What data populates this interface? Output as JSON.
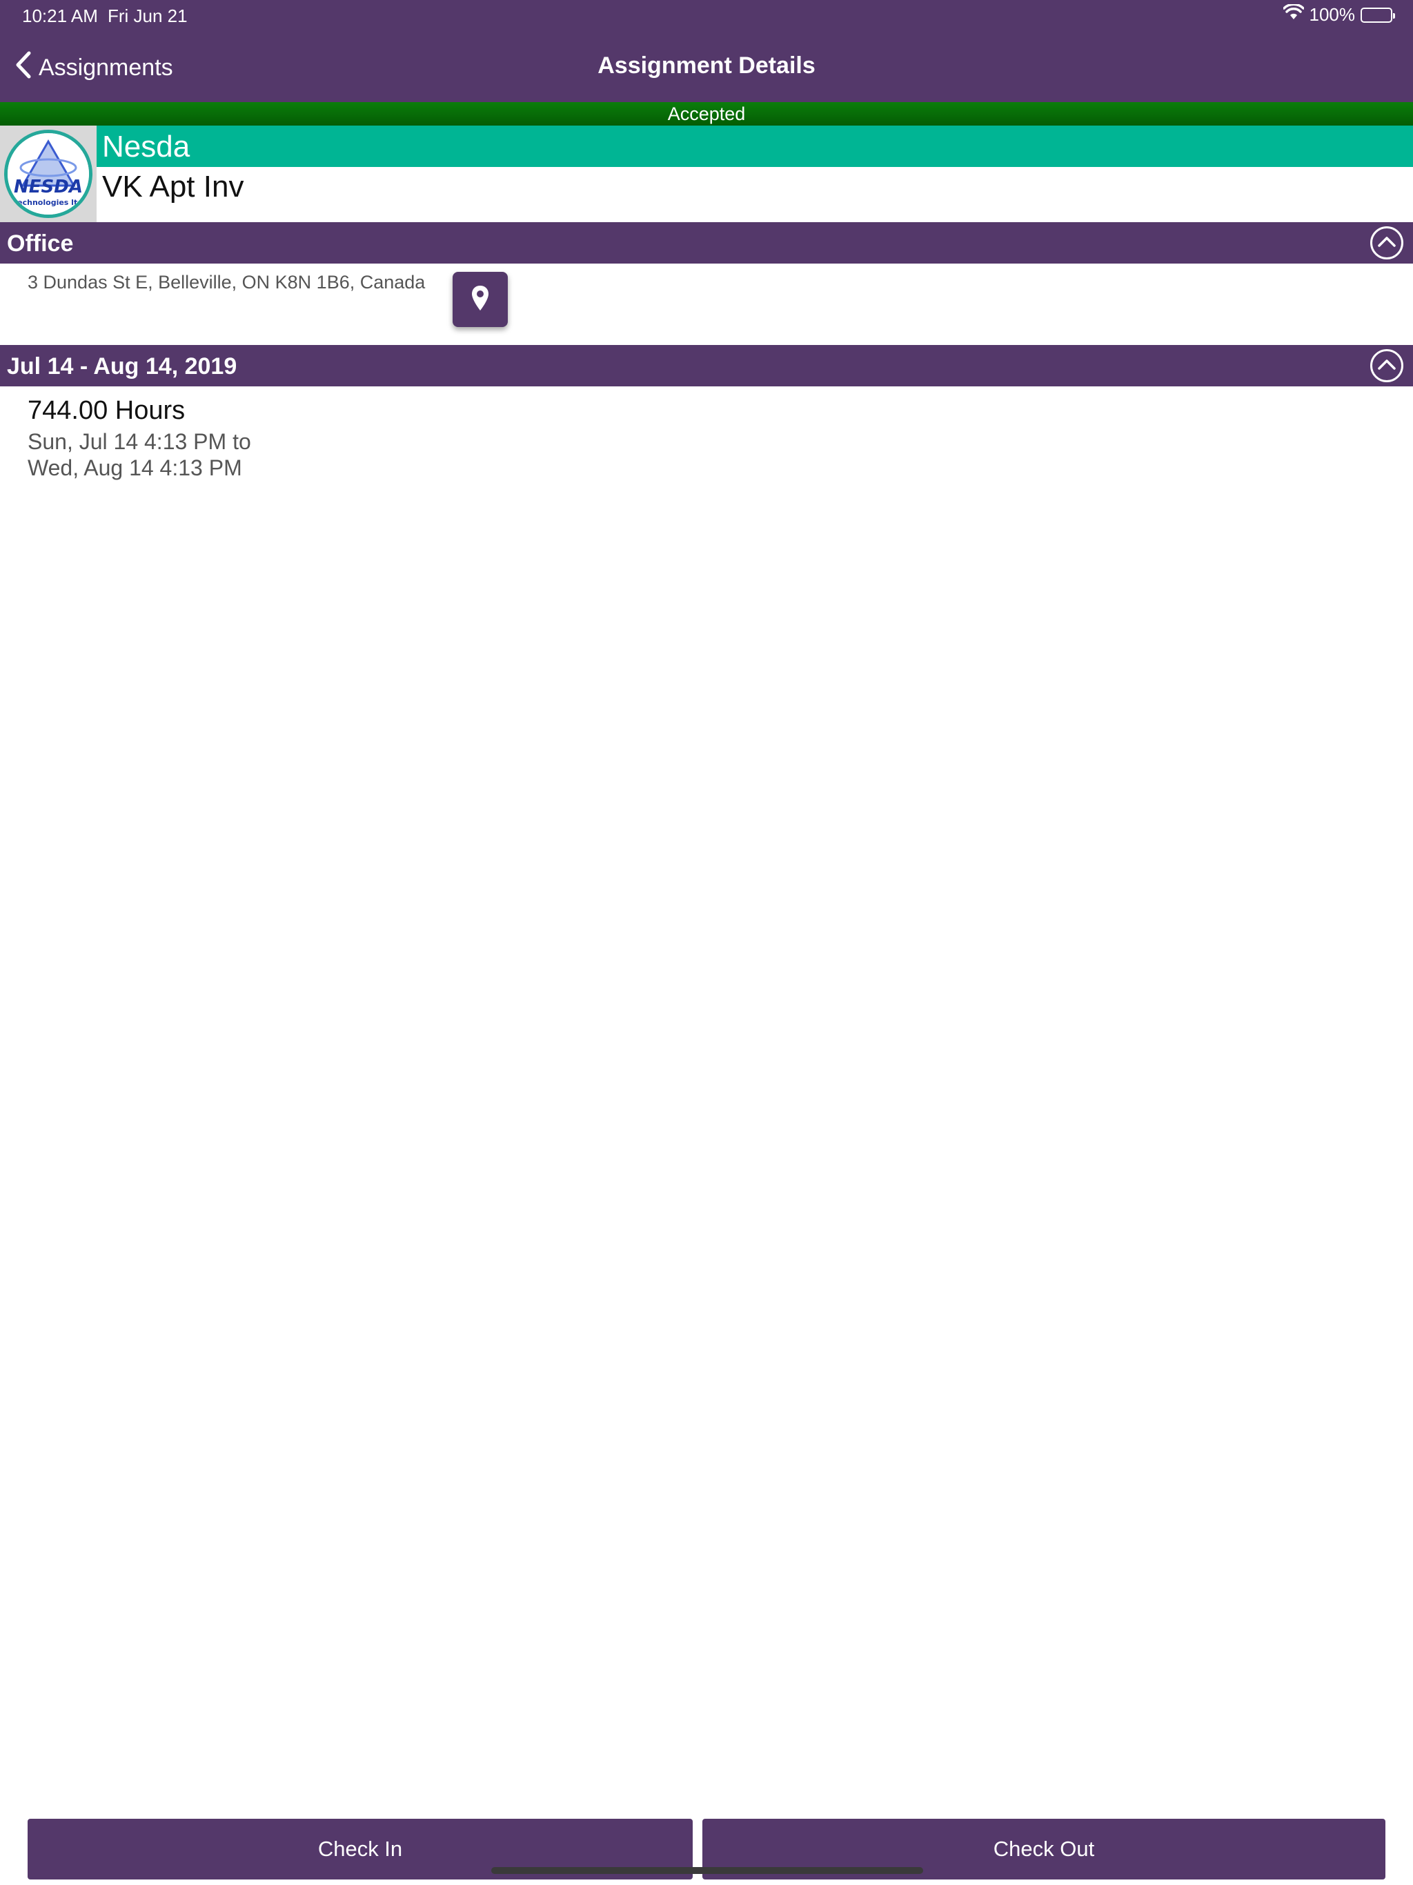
{
  "status_bar": {
    "time": "10:21 AM",
    "date": "Fri Jun 21",
    "battery": "100%"
  },
  "nav": {
    "back_label": "Assignments",
    "title": "Assignment Details"
  },
  "assignment": {
    "status": "Accepted",
    "company": "Nesda",
    "project": "VK Apt Inv",
    "logo_text": "NESDA",
    "logo_subtext": "technologies ltd"
  },
  "location_section": {
    "title": "Office",
    "address": "3 Dundas St E, Belleville, ON K8N 1B6, Canada"
  },
  "schedule_section": {
    "title": "Jul 14 - Aug 14, 2019",
    "hours": "744.00 Hours",
    "start": "Sun, Jul 14 4:13 PM to",
    "end": "Wed, Aug 14 4:13 PM"
  },
  "actions": {
    "check_in": "Check In",
    "check_out": "Check Out"
  },
  "colors": {
    "primary": "#54386a",
    "accepted": "#0b7e0b",
    "company_band": "#00b594"
  },
  "icons": {
    "back": "chevron-left-icon",
    "collapse": "chevron-up-icon",
    "map": "map-pin-icon",
    "wifi": "wifi-icon",
    "battery": "battery-icon"
  }
}
